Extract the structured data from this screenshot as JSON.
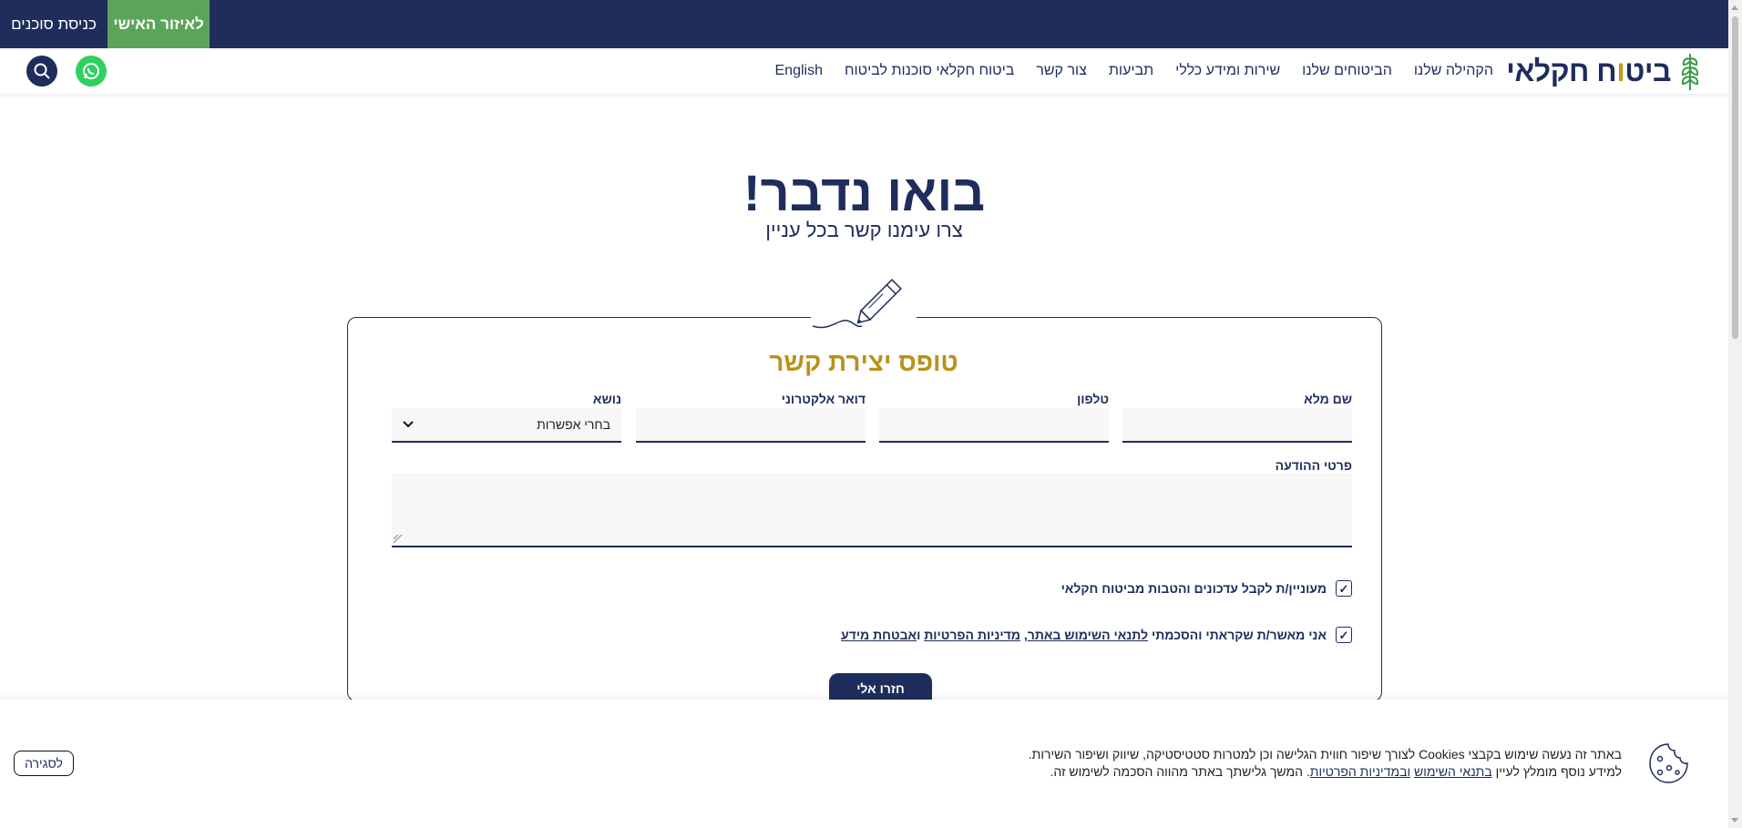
{
  "topbar": {
    "agents_label": "כניסת סוכנים",
    "personal_area_label": "לאיזור האישי"
  },
  "header": {
    "logo_text_before_dot": "ביט",
    "logo_text_dot": "ו",
    "logo_text_after_dot": "ח חקלאי",
    "nav": [
      {
        "label": "הקהילה שלנו"
      },
      {
        "label": "הביטוחים שלנו"
      },
      {
        "label": "שירות ומידע כללי"
      },
      {
        "label": "תביעות"
      },
      {
        "label": "צור קשר"
      },
      {
        "label": "ביטוח חקלאי סוכנות לביטוח"
      },
      {
        "label": "English"
      }
    ],
    "whatsapp_icon": "whatsapp-icon",
    "search_icon": "search-icon"
  },
  "hero": {
    "title": "בואו נדבר!",
    "subtitle": "צרו עימנו קשר בכל עניין"
  },
  "form": {
    "title": "טופס יצירת קשר",
    "full_name_label": "שם מלא",
    "phone_label": "טלפון",
    "email_label": "דואר אלקטרוני",
    "topic_label": "נושא",
    "topic_value": "בחרי אפשרות",
    "message_label": "פרטי ההודעה",
    "newsletter_label": "מעוניין/ת לקבל עדכונים והטבות מביטוח חקלאי",
    "newsletter_checked": true,
    "terms_prefix": "אני מאשר/ת שקראתי והסכמתי",
    "terms_link": "לתנאי השימוש באתר",
    "terms_comma": ",",
    "privacy_link": "מדיניות הפרטיות",
    "terms_and": "ו",
    "security_link": "אבטחת מידע",
    "terms_checked": true,
    "check_mark": "✓",
    "submit_label": "חזרו אלי"
  },
  "cookie": {
    "line1": "באתר זה נעשה שימוש בקבצי Cookies לצורך שיפור חווית הגלישה וכן למטרות סטטיסטיקה, שיווק ושיפור השירות.",
    "line2_prefix": "למידע נוסף מומלץ לעיין",
    "terms_link": "בתנאי השימוש",
    "and_privacy_link": "ובמדיניות הפרטיות",
    "line2_suffix": ". המשך גלישתך באתר מהווה הסכמה לשימוש זה.",
    "close_label": "לסגירה",
    "icon": "cookie-icon"
  },
  "colors": {
    "navy": "#1f2d5c",
    "green": "#5aa55a",
    "gold": "#b8921b",
    "whatsapp": "#2fd060"
  }
}
